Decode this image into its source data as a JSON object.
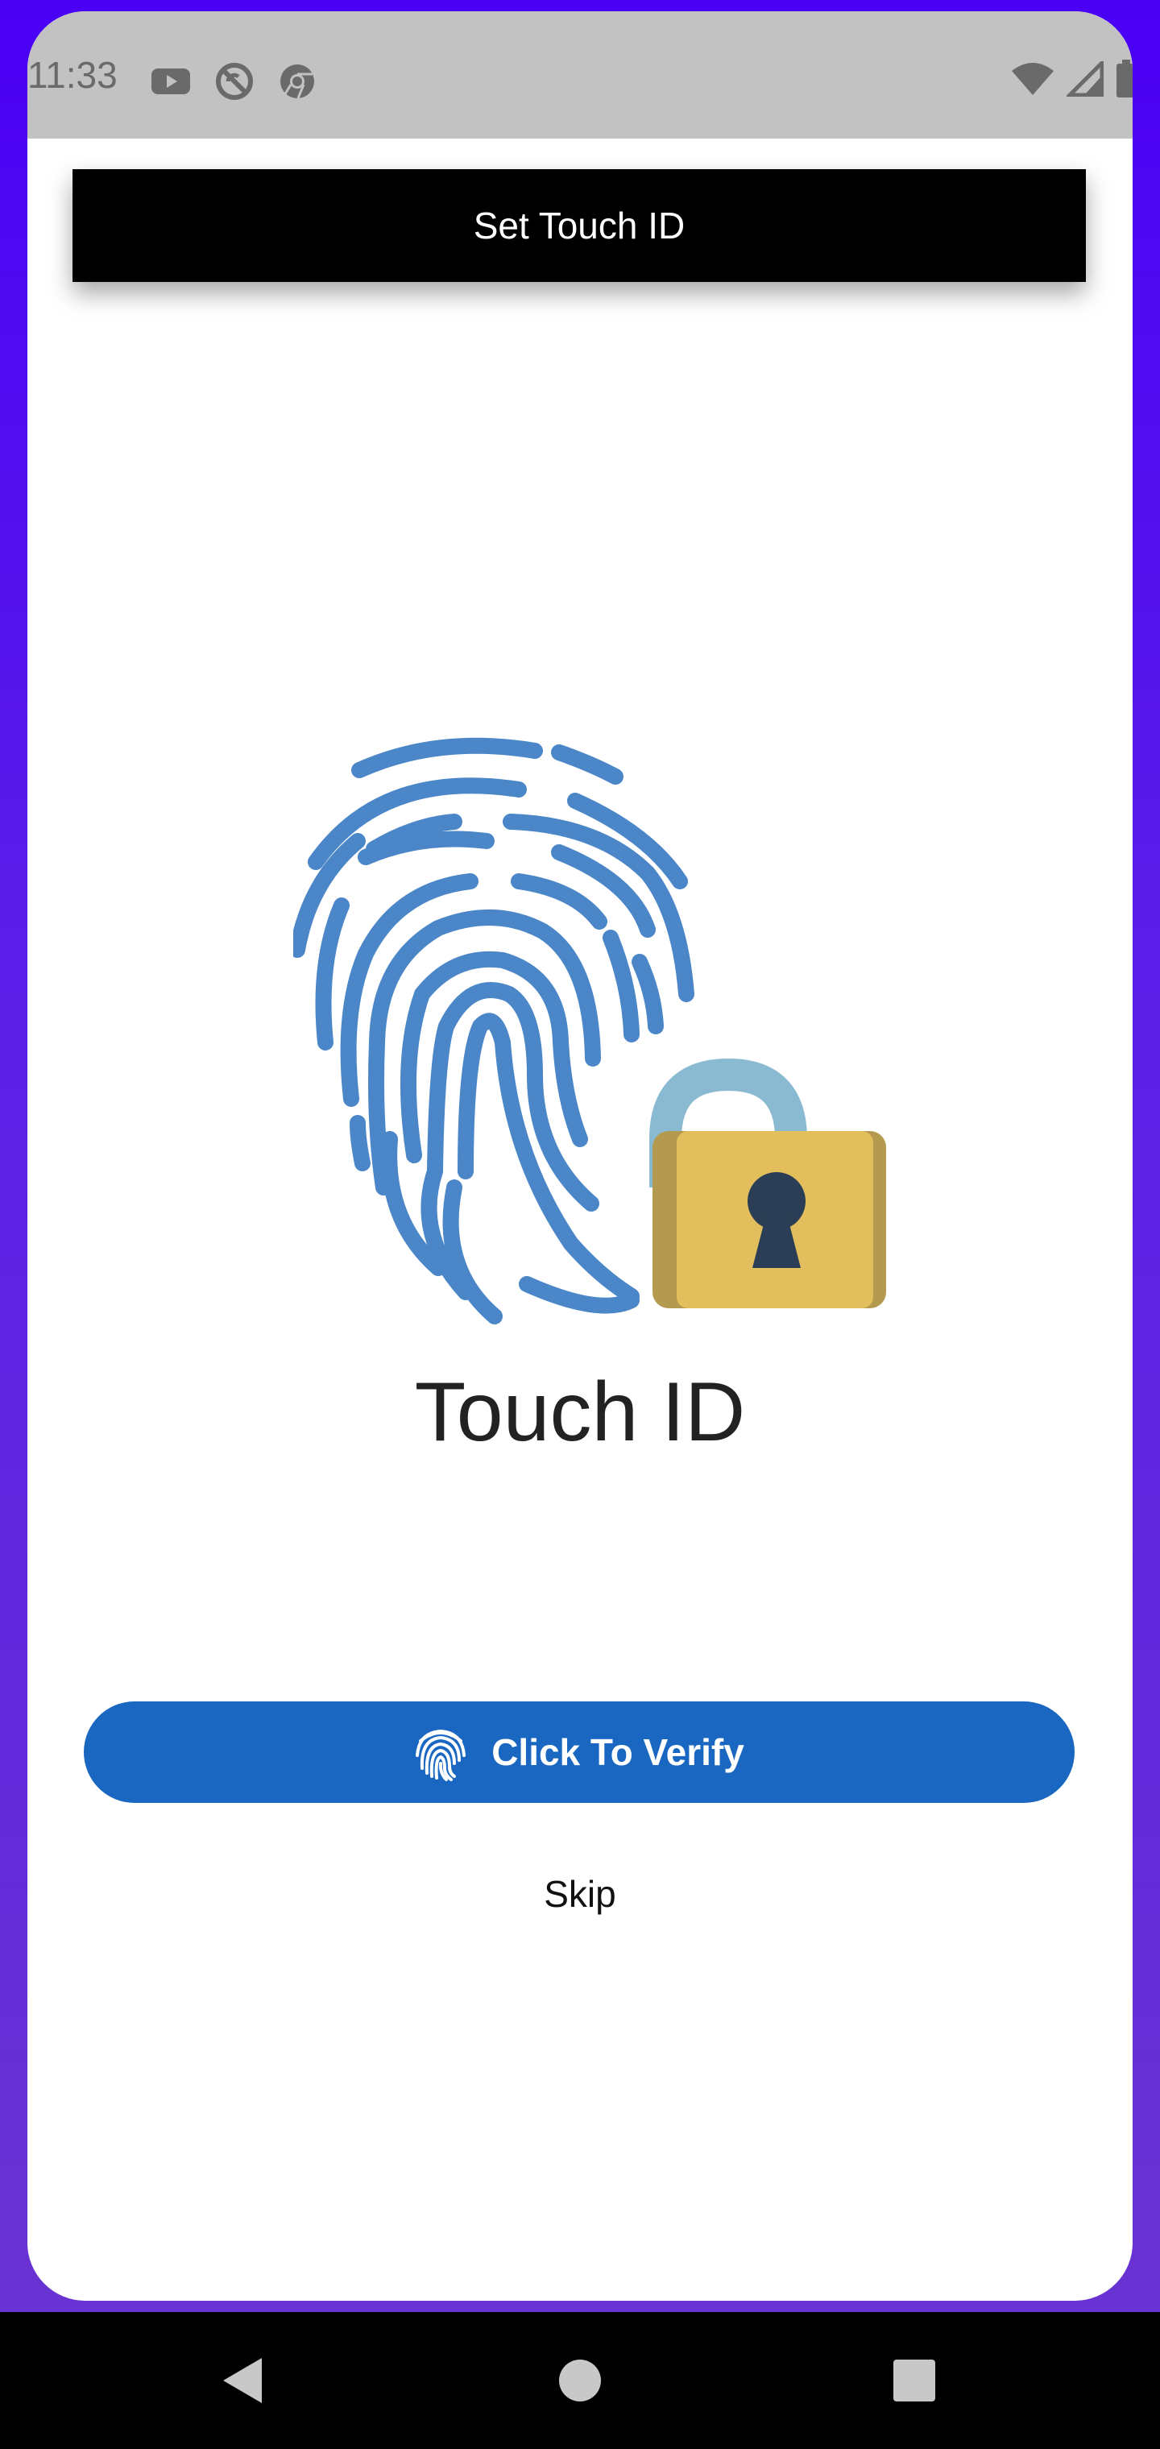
{
  "status_bar": {
    "time": "11:33",
    "left_icons": [
      "youtube-icon",
      "no-sync-icon",
      "chrome-icon"
    ],
    "right_icons": [
      "wifi-icon",
      "signal-icon",
      "battery-icon"
    ]
  },
  "toolbar": {
    "title": "Set Touch ID"
  },
  "hero": {
    "icon": "fingerprint-lock-icon"
  },
  "main": {
    "title": "Touch ID",
    "verify_button_label": "Click To Verify",
    "verify_button_icon": "fingerprint-icon",
    "skip_label": "Skip"
  },
  "nav_bar": {
    "buttons": [
      "back-icon",
      "home-icon",
      "recents-icon"
    ]
  },
  "colors": {
    "background_top": "#4a00f5",
    "card": "#ffffff",
    "toolbar": "#000000",
    "accent_button": "#1a67c2",
    "fingerprint": "#4a86c8",
    "lock_body": "#e3be5c",
    "lock_side": "#b49a4e",
    "lock_shackle": "#8ab9d2",
    "keyhole": "#2b3e55"
  }
}
